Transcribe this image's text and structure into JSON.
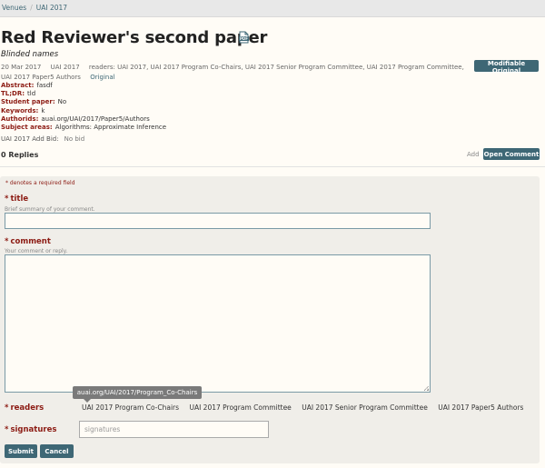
{
  "breadcrumb": {
    "items": [
      "Venues",
      "UAI 2017"
    ]
  },
  "paper": {
    "title": "Red Reviewer's second paper",
    "authors": "Blinded names",
    "date": "20 Mar 2017",
    "venue": "UAI 2017",
    "readers": "readers: UAI 2017, UAI 2017 Program Co-Chairs, UAI 2017 Senior Program Committee, UAI 2017 Program Committee, UAI 2017 Paper5 Authors",
    "original_link": "Original",
    "modifiable_button": "Modifiable Original",
    "pdf_icon": "pdf-icon"
  },
  "fields": [
    {
      "key": "Abstract:",
      "value": "fasdf"
    },
    {
      "key": "TL;DR:",
      "value": "tld"
    },
    {
      "key": "Student paper:",
      "value": "No"
    },
    {
      "key": "Keywords:",
      "value": "k"
    },
    {
      "key": "Authorids:",
      "value": "auai.org/UAI/2017/Paper5/Authors"
    },
    {
      "key": "Subject areas:",
      "value": "Algorithms: Approximate Inference"
    }
  ],
  "bid": {
    "key": "UAI 2017 Add Bid:",
    "value": "No bid"
  },
  "replies": {
    "count_label": "0 Replies",
    "add_label": "Add",
    "open_comment_button": "Open Comment"
  },
  "form": {
    "required_note": "* denotes a required field",
    "title_label": "title",
    "title_help": "Brief summary of your comment.",
    "comment_label": "comment",
    "comment_help": "Your comment or reply.",
    "readers_label": "readers",
    "readers_tooltip": "auai.org/UAI/2017/Program_Co-Chairs",
    "reader_options": [
      "UAI 2017 Program Co-Chairs",
      "UAI 2017 Program Committee",
      "UAI 2017 Senior Program Committee",
      "UAI 2017 Paper5 Authors"
    ],
    "signatures_label": "signatures",
    "signatures_placeholder": "signatures",
    "submit_button": "Submit",
    "cancel_button": "Cancel",
    "required_star": "*"
  }
}
